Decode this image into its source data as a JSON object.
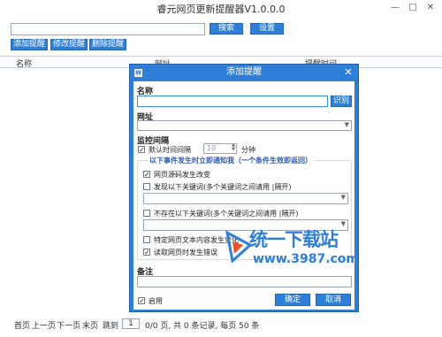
{
  "window": {
    "title": "睿元网页更新提醒器V1.0.0.0",
    "minimize": "—",
    "maximize": "□",
    "close": "✕"
  },
  "toolbar": {
    "search_value": "",
    "search_label": "搜索",
    "settings_label": "设置",
    "add_label": "添加提醒",
    "edit_label": "修改提醒",
    "delete_label": "删除提醒"
  },
  "table": {
    "columns": [
      "名称",
      "网址",
      "提醒时间"
    ]
  },
  "pager": {
    "first": "首页",
    "prev": "上一页",
    "next": "下一页",
    "last": "末页",
    "jump": "跳到",
    "page_value": "1",
    "summary": "0/0 页, 共 0 条记录, 每页 50 条"
  },
  "dialog": {
    "title": "添加提醒",
    "close": "✕",
    "name_label": "名称",
    "identify_label": "识别",
    "url_label": "网址",
    "monitor_label": "监控间隔",
    "default_interval_label": "默认时间间隔",
    "interval_value": "10",
    "minutes_label": "分钟",
    "group_title": "以下事件发生时立即通知我（一个条件生效即返回）",
    "opt_source_changed": "网页源码发生改变",
    "opt_keywords_found": "发现以下关键词(多个关键词之间请用 |隔开)",
    "opt_keywords_missing": "不存在以下关键词(多个关键词之间请用 |隔开)",
    "opt_text_changed": "特定网页文本内容发生变化",
    "opt_read_error": "读取网页时发生错误",
    "note_label": "备注",
    "enable_label": "启用",
    "ok_label": "确定",
    "cancel_label": "取消",
    "checked_mark": "✓"
  },
  "watermark": {
    "text": "统一下载站",
    "url": "www.3987.com"
  }
}
